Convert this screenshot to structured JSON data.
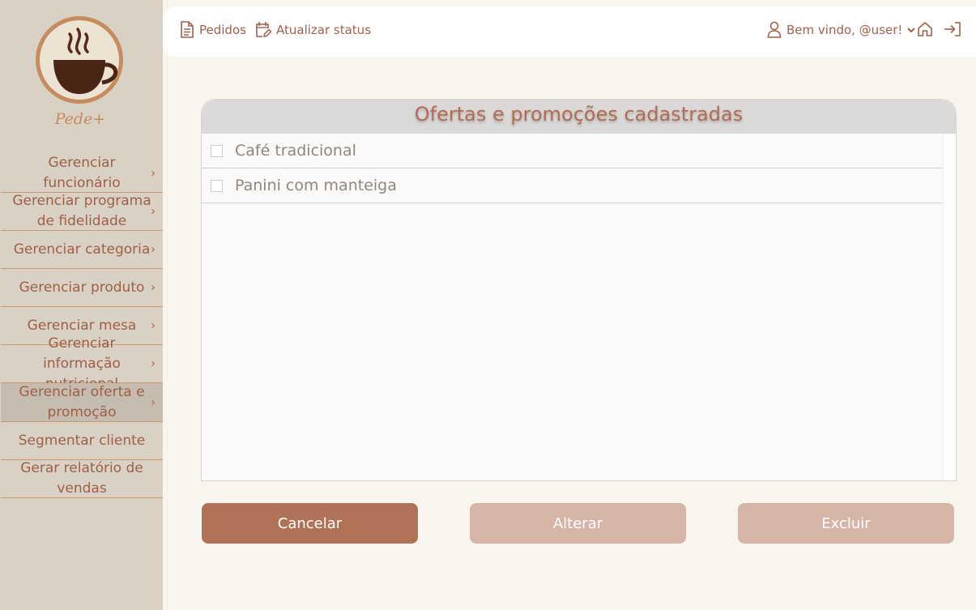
{
  "brand": {
    "name": "Pede+"
  },
  "sidebar": {
    "items": [
      {
        "label": "Gerenciar funcionário",
        "arrow": true,
        "active": false
      },
      {
        "label": "Gerenciar programa de fidelidade",
        "arrow": true,
        "active": false
      },
      {
        "label": "Gerenciar categoria",
        "arrow": true,
        "active": false
      },
      {
        "label": "Gerenciar produto",
        "arrow": true,
        "active": false
      },
      {
        "label": "Gerenciar mesa",
        "arrow": true,
        "active": false
      },
      {
        "label": "Gerenciar informação nutricional",
        "arrow": true,
        "active": false
      },
      {
        "label": "Gerenciar oferta e promoção",
        "arrow": true,
        "active": true
      },
      {
        "label": "Segmentar cliente",
        "arrow": false,
        "active": false
      },
      {
        "label": "Gerar relatório de vendas",
        "arrow": false,
        "active": false
      }
    ],
    "arrow_glyph": "›"
  },
  "topbar": {
    "orders_label": "Pedidos",
    "update_status_label": "Atualizar status",
    "welcome_label": "Bem vindo, @user!",
    "icons": [
      "document-icon",
      "calendar-edit-icon",
      "user-icon",
      "chevron-down-icon",
      "home-icon",
      "logout-icon"
    ]
  },
  "panel": {
    "title": "Ofertas e promoções cadastradas",
    "rows": [
      {
        "label": "Café tradicional",
        "checked": false
      },
      {
        "label": "Panini com manteiga",
        "checked": false
      }
    ]
  },
  "buttons": {
    "cancel": "Cancelar",
    "edit": "Alterar",
    "delete": "Excluir"
  },
  "colors": {
    "accent": "#b07256",
    "accent_disabled": "#d6b5a6",
    "text_brown": "#a86a4f",
    "sidebar_bg": "#d9d1c3",
    "sidebar_active": "#c5bcaf",
    "page_bg": "#f8f5ef"
  }
}
